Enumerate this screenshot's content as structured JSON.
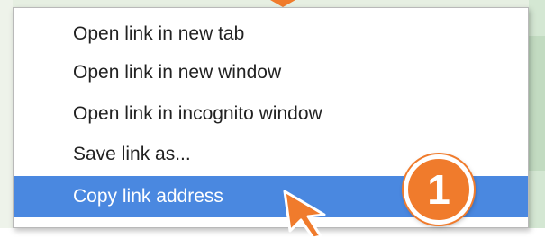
{
  "menu": {
    "items": [
      {
        "label": "Open link in new tab",
        "highlighted": false
      },
      {
        "label": "Open link in new window",
        "highlighted": false
      },
      {
        "label": "Open link in incognito window",
        "highlighted": false
      },
      {
        "label": "Save link as...",
        "highlighted": false
      },
      {
        "label": "Copy link address",
        "highlighted": true
      }
    ]
  },
  "annotation": {
    "step_number": "1",
    "badge_color": "#f07b2c",
    "arrow_color": "#f07b2c"
  },
  "colors": {
    "highlight": "#4a88e0",
    "menu_text": "#222222"
  }
}
